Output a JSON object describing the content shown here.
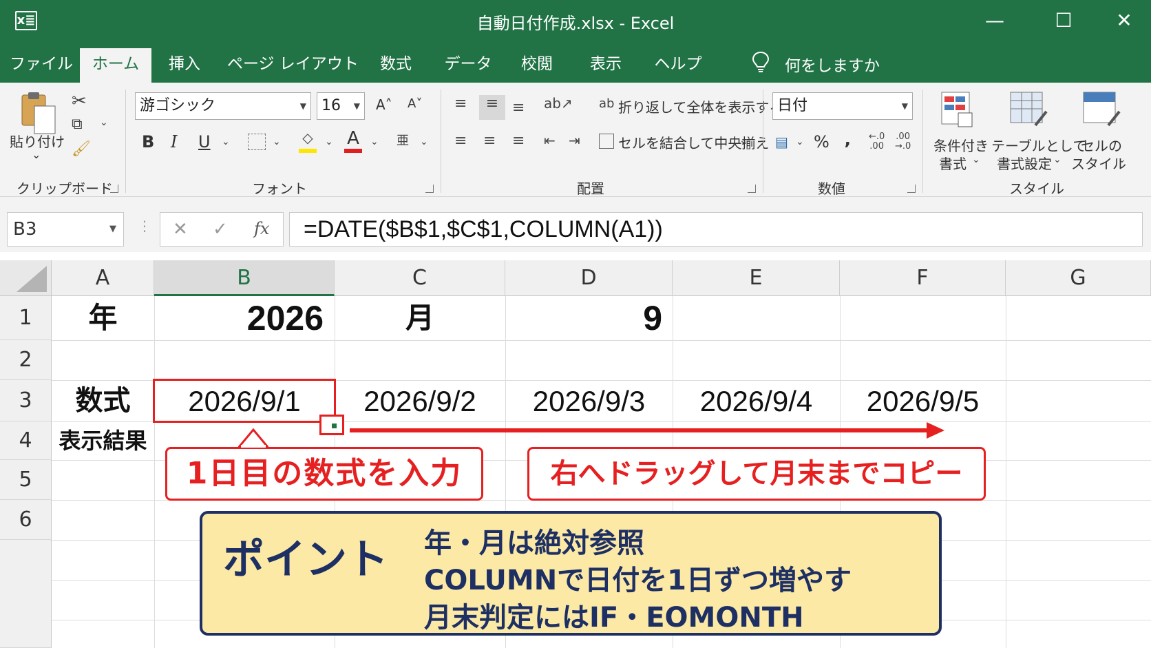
{
  "window": {
    "title": "自動日付作成.xlsx  -  Excel",
    "logo": "x≣",
    "minimize": "—",
    "maximize": "☐",
    "close": "✕"
  },
  "tabs": [
    "ファイル",
    "ホーム",
    "挿入",
    "ページ レイアウト",
    "数式",
    "データ",
    "校閲",
    "表示",
    "ヘルプ"
  ],
  "active_tab": "ホーム",
  "tell_me": "何をしますか",
  "ribbon": {
    "clipboard": {
      "paste_label_1": "貼り付け",
      "paste_label_2": "⌄",
      "group": "クリップボード"
    },
    "font": {
      "name": "游ゴシック",
      "size": "16",
      "grow": "A˄",
      "shrink": "A˅",
      "bold": "B",
      "italic": "I",
      "underline": "U",
      "color_letter": "A",
      "group": "フォント"
    },
    "alignment": {
      "wrap": "折り返して全体を表示する",
      "merge": "セルを結合して中央揃え",
      "group": "配置"
    },
    "number": {
      "format": "日付",
      "percent": "%",
      "comma": "‚",
      "group": "数値"
    },
    "styles": {
      "cond_1": "条件付き",
      "cond_2": "書式",
      "table_1": "テーブルとして",
      "table_2": "書式設定",
      "cell_1": "セルの",
      "cell_2": "スタイル",
      "group": "スタイル"
    }
  },
  "formula_bar": {
    "name_box": "B3",
    "cancel": "✕",
    "enter": "✓",
    "fx": "fx",
    "formula": "=DATE($B$1,$C$1,COLUMN(A1))"
  },
  "sheet": {
    "columns": [
      "A",
      "B",
      "C",
      "D",
      "E",
      "F",
      "G"
    ],
    "selected_column": "B",
    "rows": [
      "1",
      "2",
      "3",
      "4",
      "5",
      "6"
    ],
    "cells": {
      "A1": "年",
      "B1": "2026",
      "C1": "月",
      "D1": "9",
      "A3": "数式",
      "A4": "表示結果",
      "B3": "2026/9/1",
      "C3": "2026/9/2",
      "D3": "2026/9/3",
      "E3": "2026/9/4",
      "F3": "2026/9/5"
    }
  },
  "annotations": {
    "callout_left": "1日目の数式を入力",
    "callout_right": "右へドラッグして月末までコピー",
    "accent_color": "#e62020",
    "point": {
      "title": "ポイント",
      "lines": [
        "年・月は絶対参照",
        "COLUMNで日付を1日ずつ増やす",
        "月末判定にはIF・EOMONTH"
      ],
      "background": "#fbe9a5",
      "border_color": "#1e2f63"
    }
  },
  "colors": {
    "excel_green": "#217346"
  }
}
